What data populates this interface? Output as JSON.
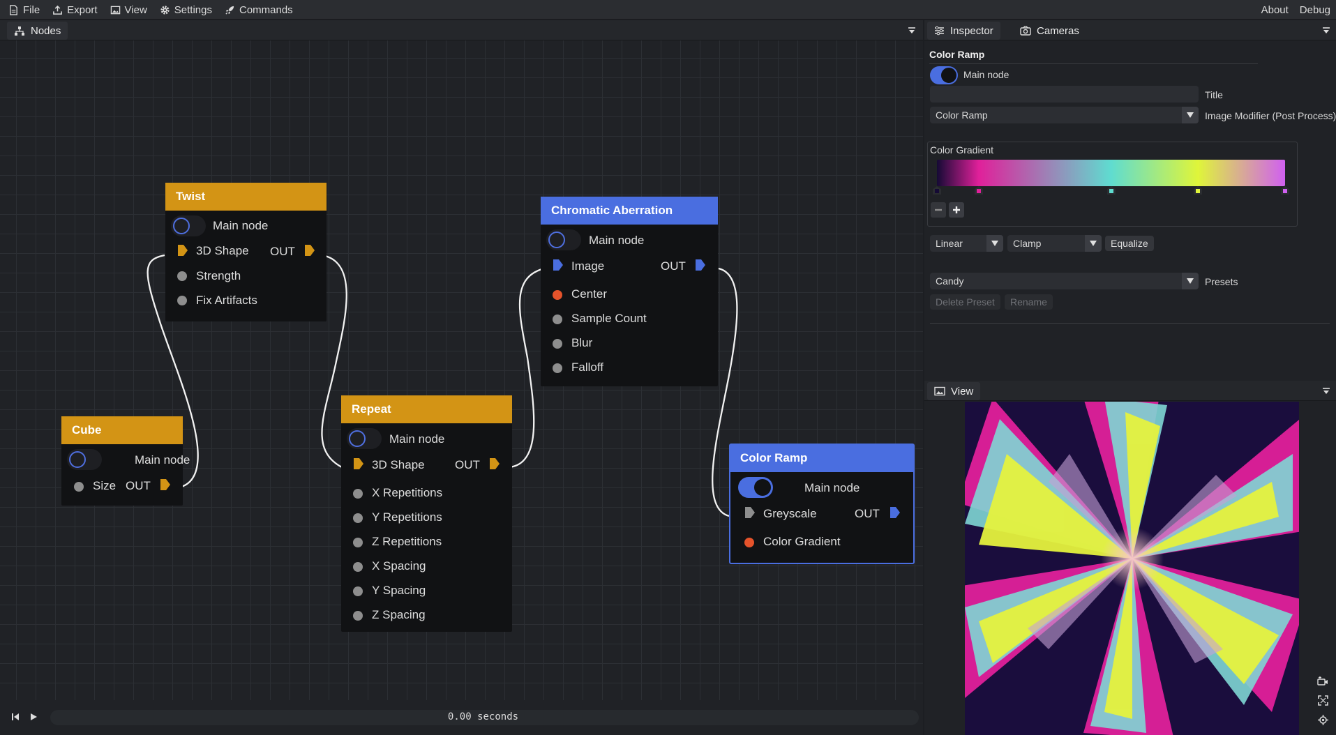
{
  "menubar": {
    "left": [
      {
        "label": "File",
        "icon": "file-icon"
      },
      {
        "label": "Export",
        "icon": "export-icon"
      },
      {
        "label": "View",
        "icon": "image-icon"
      },
      {
        "label": "Settings",
        "icon": "gear-icon"
      },
      {
        "label": "Commands",
        "icon": "rocket-icon"
      }
    ],
    "right": [
      "About",
      "Debug"
    ]
  },
  "nodes_panel": {
    "tab": "Nodes",
    "nodes": {
      "twist": {
        "title": "Twist",
        "main": "Main node",
        "input": "3D Shape",
        "out": "OUT",
        "params": [
          "Strength",
          "Fix Artifacts"
        ]
      },
      "cube": {
        "title": "Cube",
        "main": "Main node",
        "param": "Size",
        "out": "OUT"
      },
      "repeat": {
        "title": "Repeat",
        "main": "Main node",
        "input": "3D Shape",
        "out": "OUT",
        "params": [
          "X Repetitions",
          "Y Repetitions",
          "Z Repetitions",
          "X Spacing",
          "Y Spacing",
          "Z Spacing"
        ]
      },
      "chromatic": {
        "title": "Chromatic Aberration",
        "main": "Main node",
        "input": "Image",
        "out": "OUT",
        "params": [
          "Center",
          "Sample Count",
          "Blur",
          "Falloff"
        ]
      },
      "colorramp": {
        "title": "Color Ramp",
        "main": "Main node",
        "input": "Greyscale",
        "out": "OUT",
        "params": [
          "Color Gradient"
        ]
      }
    }
  },
  "inspector": {
    "tabs": [
      "Inspector",
      "Cameras"
    ],
    "heading": "Color Ramp",
    "main_node_label": "Main node",
    "main_node_on": true,
    "title_value": "",
    "title_label": "Title",
    "type_value": "Color Ramp",
    "type_label": "Image Modifier (Post Process)",
    "gradient_label": "Color Gradient",
    "gradient_stops": [
      {
        "pos": 0.0,
        "color": "#150a35"
      },
      {
        "pos": 0.12,
        "color": "#e0209a"
      },
      {
        "pos": 0.5,
        "color": "#5fdcd0"
      },
      {
        "pos": 0.75,
        "color": "#dff53a"
      },
      {
        "pos": 1.0,
        "color": "#d060f0"
      }
    ],
    "interp": "Linear",
    "mode": "Clamp",
    "equalize": "Equalize",
    "preset_value": "Candy",
    "presets_label": "Presets",
    "delete_preset": "Delete Preset",
    "rename": "Rename"
  },
  "view_panel": {
    "tab": "View"
  },
  "timeline": {
    "time": "0.00 seconds"
  },
  "colors": {
    "orange": "#d39415",
    "blue": "#4a6ee0",
    "red_dot": "#e6532b",
    "gray_dot": "#8e8e8e"
  }
}
